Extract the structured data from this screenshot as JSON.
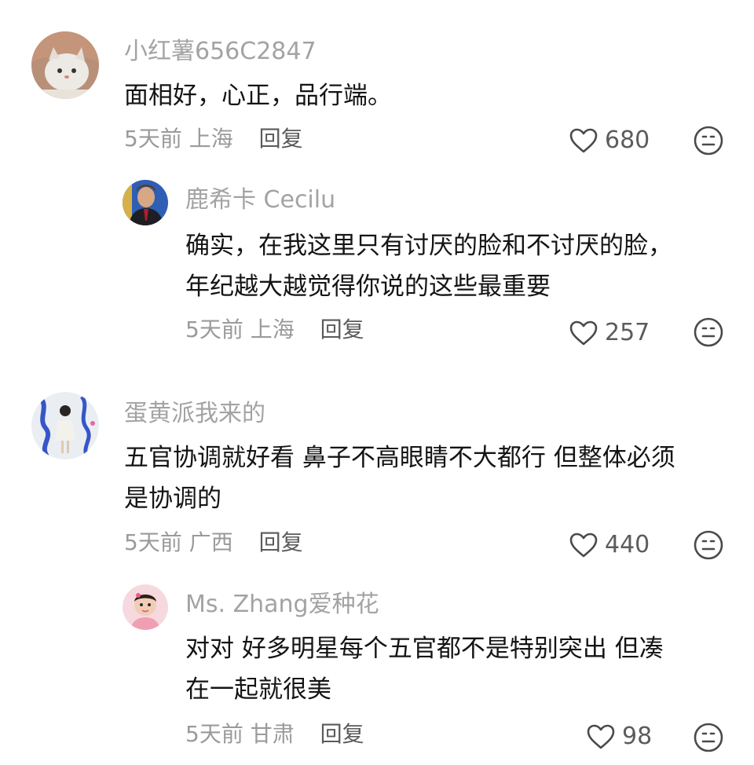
{
  "comments": [
    {
      "username": "小红薯656C2847",
      "lines": [
        "面相好，心正，品行端。"
      ],
      "time": "5天前",
      "location": "上海",
      "reply_label": "回复",
      "likes": "680"
    },
    {
      "username": "鹿希卡 Cecilu",
      "lines": [
        "确实，在我这里只有讨厌的脸和不讨厌的脸，",
        "年纪越大越觉得你说的这些最重要"
      ],
      "time": "5天前",
      "location": "上海",
      "reply_label": "回复",
      "likes": "257"
    },
    {
      "username": "蛋黄派我来的",
      "lines": [
        "五官协调就好看 鼻子不高眼睛不大都行 但整体必须",
        "是协调的"
      ],
      "time": "5天前",
      "location": "广西",
      "reply_label": "回复",
      "likes": "440"
    },
    {
      "username": "Ms. Zhang爱种花",
      "lines": [
        "对对 好多明星每个五官都不是特别突出 但凑",
        "在一起就很美"
      ],
      "time": "5天前",
      "location": "甘肃",
      "reply_label": "回复",
      "likes": "98"
    }
  ],
  "icons": {
    "like": "heart-outline-icon",
    "dislike": "neutral-face-icon"
  },
  "colors": {
    "username": "#a3a3a3",
    "text": "#141414",
    "meta": "#9a9a9a",
    "icon": "#4a4a4a"
  }
}
